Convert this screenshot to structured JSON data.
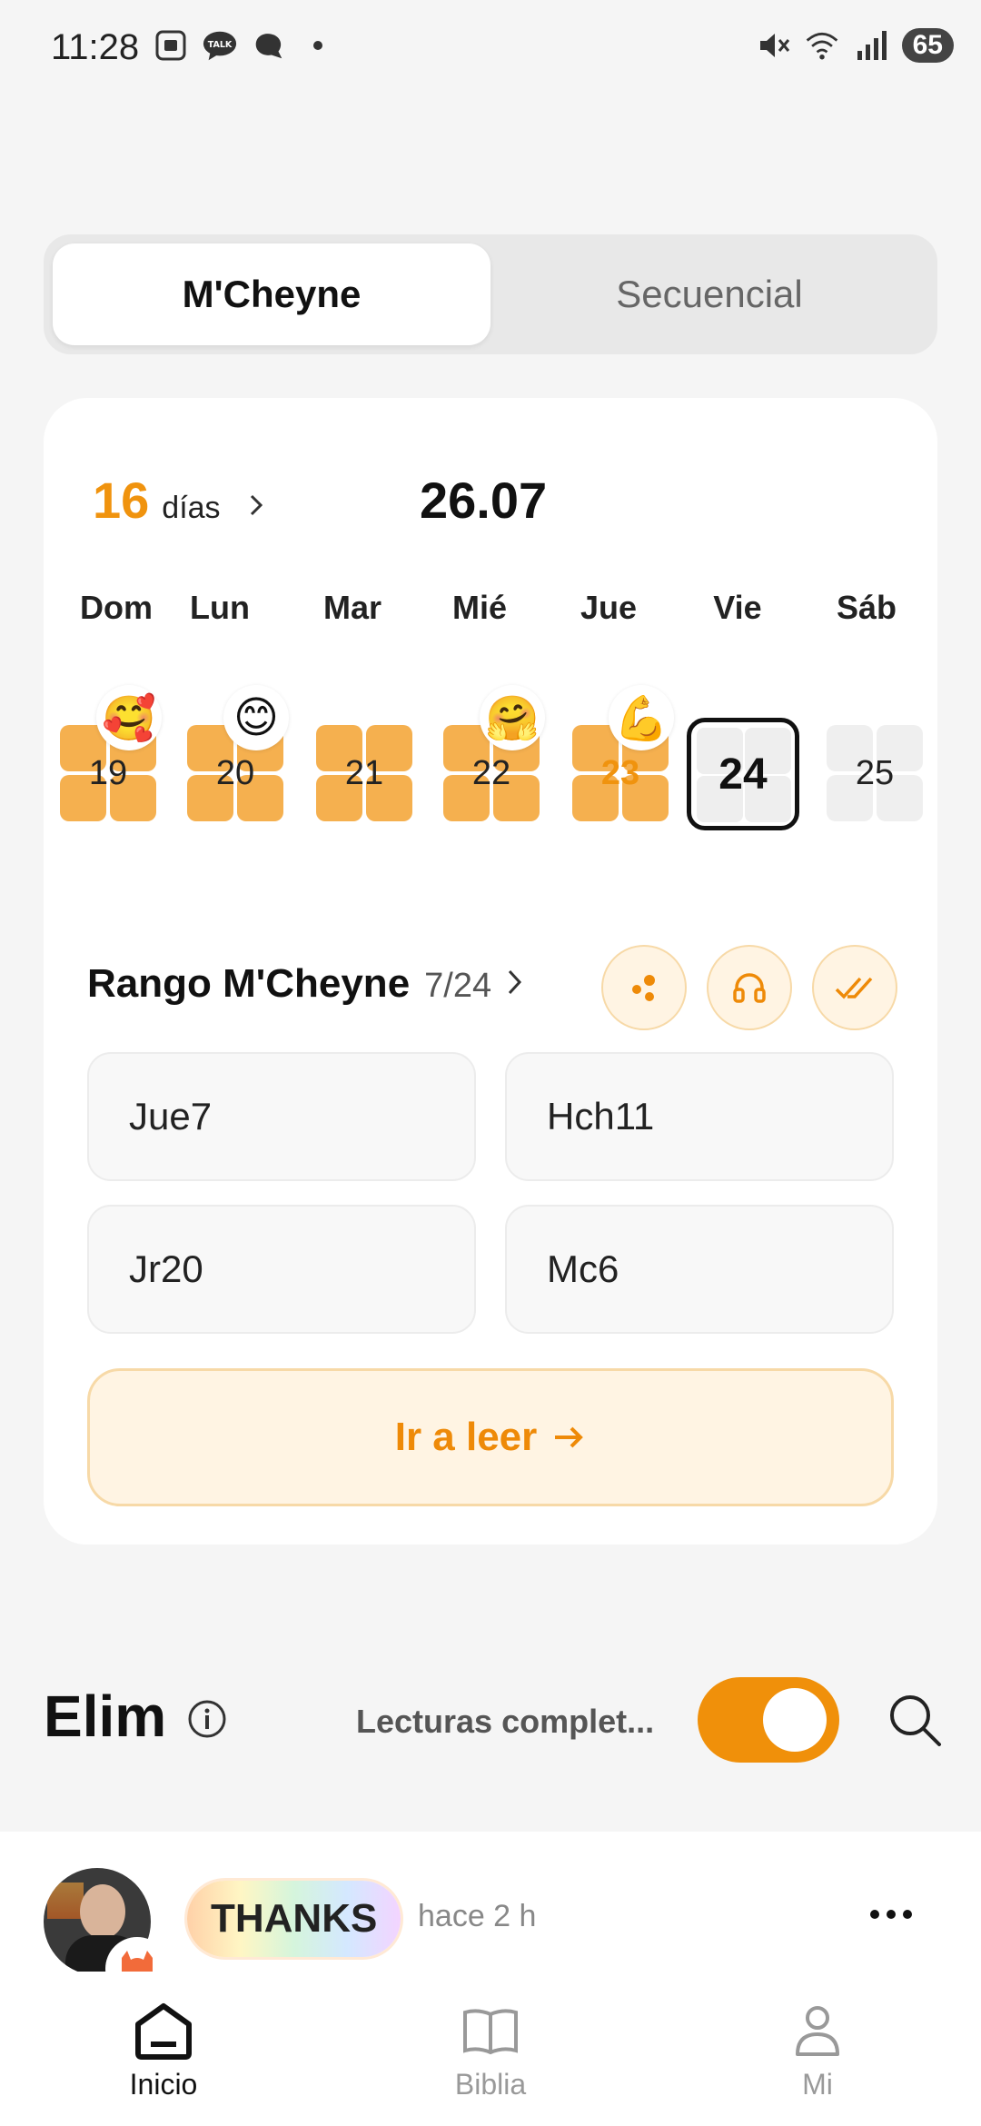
{
  "status_bar": {
    "time": "11:28",
    "battery": "65",
    "talk_label": "TALK"
  },
  "segmented": {
    "active": "M'Cheyne",
    "inactive": "Secuencial"
  },
  "plan": {
    "streak_number": "16",
    "streak_unit": "días",
    "date": "26.07",
    "weekdays": [
      "Dom",
      "Lun",
      "Mar",
      "Mié",
      "Jue",
      "Vie",
      "Sáb"
    ],
    "days": [
      {
        "num": "19",
        "emoji": "🥰",
        "done": true
      },
      {
        "num": "20",
        "emoji": "😊",
        "done": true
      },
      {
        "num": "21",
        "emoji": "",
        "done": true
      },
      {
        "num": "22",
        "emoji": "🤗",
        "done": true
      },
      {
        "num": "23",
        "emoji": "💪",
        "done": true
      },
      {
        "num": "24",
        "emoji": "",
        "done": false
      },
      {
        "num": "25",
        "emoji": "",
        "done": false
      }
    ],
    "range_title": "Rango M'Cheyne",
    "range_count": "7/24",
    "chapters": [
      "Jue7",
      "Hch11",
      "Jr20",
      "Mc6"
    ],
    "read_button": "Ir a leer",
    "accent_color": "#f0930e"
  },
  "group": {
    "name": "Elim",
    "label": "Lecturas complet...",
    "toggle_on": true
  },
  "feed": {
    "badge": "THANKS",
    "time_ago": "hace 2 h"
  },
  "nav": {
    "home": "Inicio",
    "bible": "Biblia",
    "me": "Mi"
  }
}
